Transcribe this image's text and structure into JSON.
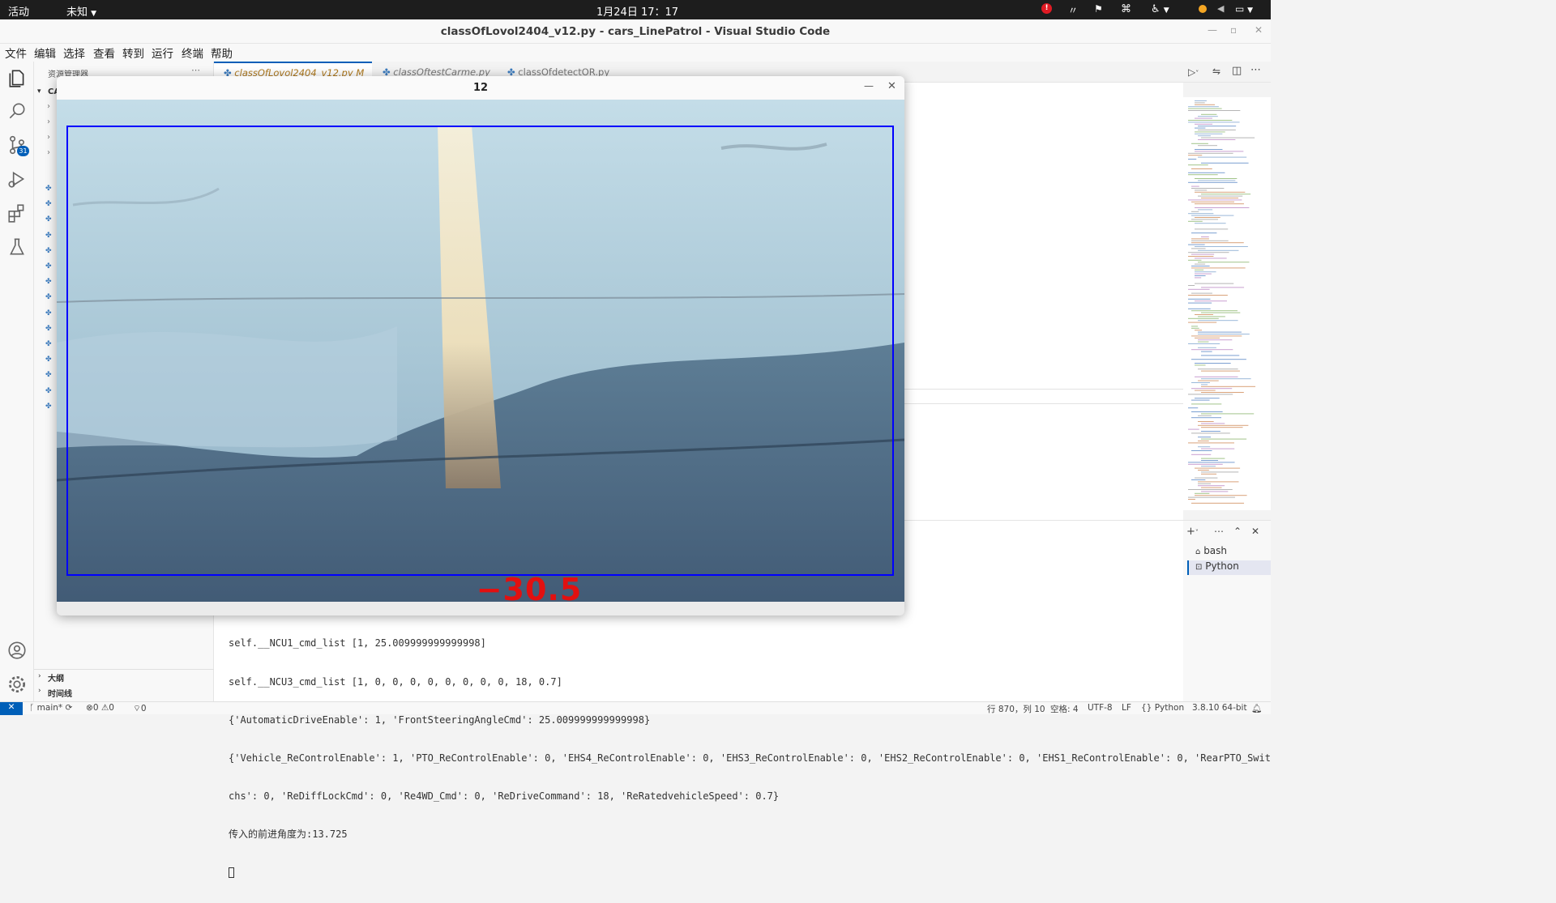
{
  "topbar": {
    "activities": "活动",
    "app_menu": "未知",
    "clock": "1月24日  17：17"
  },
  "window": {
    "title": "classOfLovol2404_v12.py - cars_LinePatrol - Visual Studio Code"
  },
  "menu": [
    "文件",
    "编辑",
    "选择",
    "查看",
    "转到",
    "运行",
    "终端",
    "帮助"
  ],
  "activity_bar": {
    "scm_badge": "31"
  },
  "explorer": {
    "header": "资源管理器",
    "root_label": "CA",
    "outline": "大纲",
    "timeline": "时间线"
  },
  "tabs": [
    {
      "label": "classOfLovol2404_v12.py",
      "status": "M",
      "active": true
    },
    {
      "label": "classOftestCarme.py",
      "active": false
    },
    {
      "label": "classOfdetectOR.py",
      "active": false
    }
  ],
  "popup": {
    "title": "12",
    "angle_text": "−30.5",
    "rect_color": "#0000ff",
    "angle_color": "#e21010"
  },
  "terminal": {
    "lines": [
      "self.__NCU1_cmd_list [1, 25.009999999999998]",
      "self.__NCU3_cmd_list [1, 0, 0, 0, 0, 0, 0, 0, 0, 18, 0.7]",
      "{'AutomaticDriveEnable': 1, 'FrontSteeringAngleCmd': 25.009999999999998}",
      "{'Vehicle_ReControlEnable': 1, 'PTO_ReControlEnable': 0, 'EHS4_ReControlEnable': 0, 'EHS3_ReControlEnable': 0, 'EHS2_ReControlEnable': 0, 'EHS1_ReControlEnable': 0, 'RearPTO_Swit",
      "chs': 0, 'ReDiffLockCmd': 0, 'Re4WD_Cmd': 0, 'ReDriveCommand': 18, 'ReRatedvehicleSpeed': 0.7}",
      "传入的前进角度为:13.725"
    ],
    "sessions": [
      "bash",
      "Python"
    ]
  },
  "statusbar": {
    "branch": "main*",
    "errors": "0",
    "warnings": "0",
    "ports": "0",
    "position": "行 870，列 10",
    "spaces": "空格: 4",
    "encoding": "UTF-8",
    "eol": "LF",
    "language": "Python",
    "interpreter": "3.8.10 64-bit"
  }
}
